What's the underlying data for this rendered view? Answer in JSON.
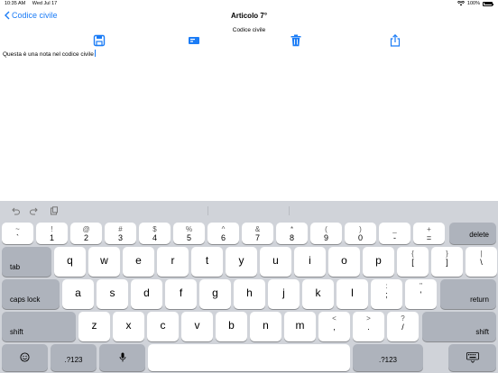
{
  "status_bar": {
    "time": "10:35 AM",
    "date": "Wed Jul 17",
    "battery_text": "100%"
  },
  "nav": {
    "back_label": "Codice civile",
    "title": "Articolo 7°",
    "subtitle": "Codice civile"
  },
  "toolbar": {
    "icons": [
      "save-icon",
      "card-icon",
      "trash-icon",
      "share-icon"
    ],
    "accent": "#1b7cf6"
  },
  "note": {
    "text": "Questa è una nota nel codice civile"
  },
  "keyboard": {
    "toolbar_icons": [
      "undo-icon",
      "redo-icon",
      "paste-icon"
    ],
    "row1": [
      {
        "top": "~",
        "bottom": "`"
      },
      {
        "top": "!",
        "bottom": "1"
      },
      {
        "top": "@",
        "bottom": "2"
      },
      {
        "top": "#",
        "bottom": "3"
      },
      {
        "top": "$",
        "bottom": "4"
      },
      {
        "top": "%",
        "bottom": "5"
      },
      {
        "top": "^",
        "bottom": "6"
      },
      {
        "top": "&",
        "bottom": "7"
      },
      {
        "top": "*",
        "bottom": "8"
      },
      {
        "top": "(",
        "bottom": "9"
      },
      {
        "top": ")",
        "bottom": "0"
      },
      {
        "top": "_",
        "bottom": "-"
      },
      {
        "top": "+",
        "bottom": "="
      }
    ],
    "delete_label": "delete",
    "tab_label": "tab",
    "row2": [
      "q",
      "w",
      "e",
      "r",
      "t",
      "y",
      "u",
      "i",
      "o",
      "p"
    ],
    "row2_symbols": [
      {
        "top": "{",
        "bottom": "["
      },
      {
        "top": "}",
        "bottom": "]"
      },
      {
        "top": "|",
        "bottom": "\\"
      }
    ],
    "caps_label": "caps lock",
    "row3": [
      "a",
      "s",
      "d",
      "f",
      "g",
      "h",
      "j",
      "k",
      "l"
    ],
    "row3_symbols": [
      {
        "top": ":",
        "bottom": ";"
      },
      {
        "top": "\"",
        "bottom": "'"
      }
    ],
    "return_label": "return",
    "shift_label": "shift",
    "row4": [
      "z",
      "x",
      "c",
      "v",
      "b",
      "n",
      "m"
    ],
    "row4_symbols": [
      {
        "top": "<",
        "bottom": ","
      },
      {
        "top": ">",
        "bottom": "."
      },
      {
        "top": "?",
        "bottom": "/"
      }
    ],
    "numbers_label": ".?123",
    "icons": [
      "emoji-icon",
      "microphone-icon",
      "keyboard-dismiss-icon"
    ]
  }
}
